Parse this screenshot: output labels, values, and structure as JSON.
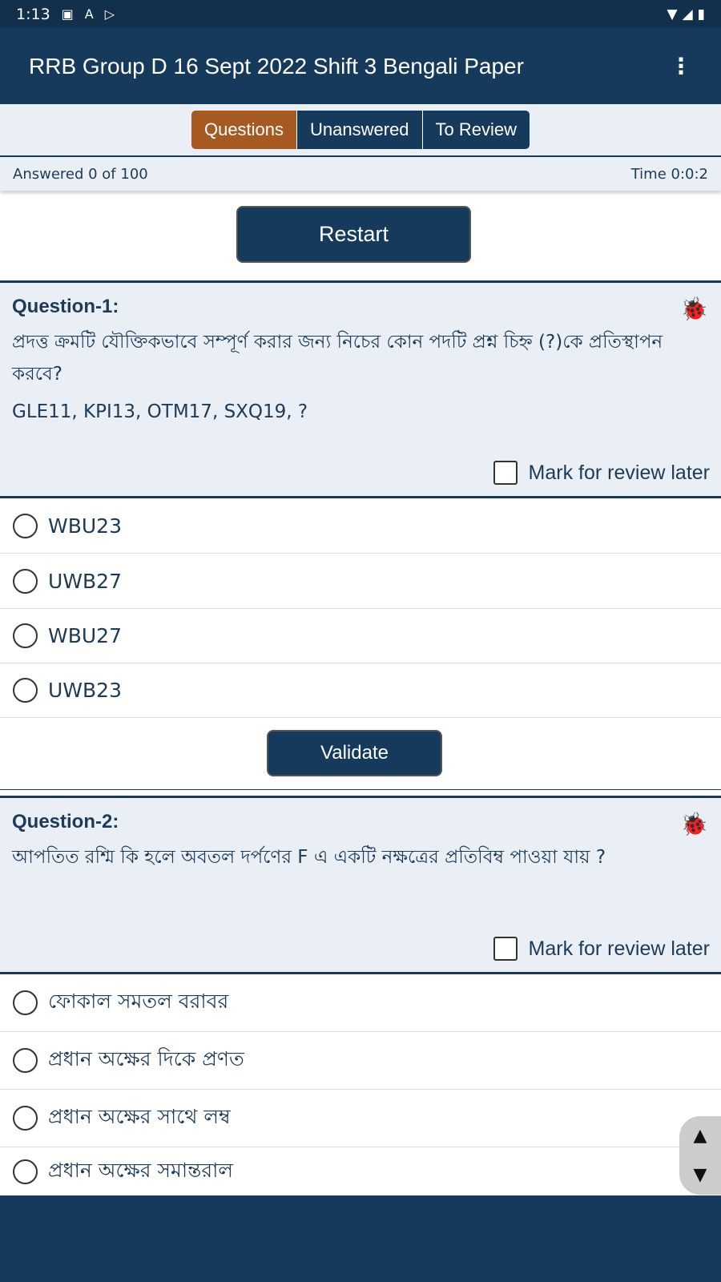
{
  "status": {
    "time": "1:13",
    "icons": [
      "image-icon",
      "font-icon",
      "play-store-icon"
    ],
    "right_icons": [
      "wifi-icon",
      "signal-icon",
      "battery-icon"
    ]
  },
  "app": {
    "title": "RRB Group D 16 Sept 2022 Shift 3 Bengali Paper"
  },
  "tabs": [
    {
      "label": "Questions",
      "active": true
    },
    {
      "label": "Unanswered"
    },
    {
      "label": "To Review"
    }
  ],
  "info": {
    "answered": "Answered 0 of 100",
    "time": "Time 0:0:2"
  },
  "restart_label": "Restart",
  "validate_label": "Validate",
  "mark_label": "Mark for review later",
  "colors": {
    "primary": "#163a5c",
    "accent": "#a65a22",
    "panel": "#e9eff5"
  },
  "questions": [
    {
      "title": "Question-1:",
      "text": "প্রদত্ত ক্রমটি যৌক্তিকভাবে সম্পূর্ণ করার জন্য নিচের কোন পদটি প্রশ্ন চিহ্ন (?)কে প্রতিস্থাপন করবে?",
      "sequence": "GLE11, KPI13, OTM17, SXQ19, ?",
      "options": [
        "WBU23",
        "UWB27",
        "WBU27",
        "UWB23"
      ]
    },
    {
      "title": "Question-2:",
      "text": "আপতিত রশ্মি কি হলে অবতল দর্পণের F এ একটি নক্ষত্রের প্রতিবিম্ব পাওয়া যায় ?",
      "options": [
        "ফোকাল সমতল বরাবর",
        "প্রধান অক্ষের দিকে প্রণত",
        "প্রধান অক্ষের সাথে লম্ব",
        "প্রধান অক্ষের সমান্তরাল"
      ]
    }
  ]
}
